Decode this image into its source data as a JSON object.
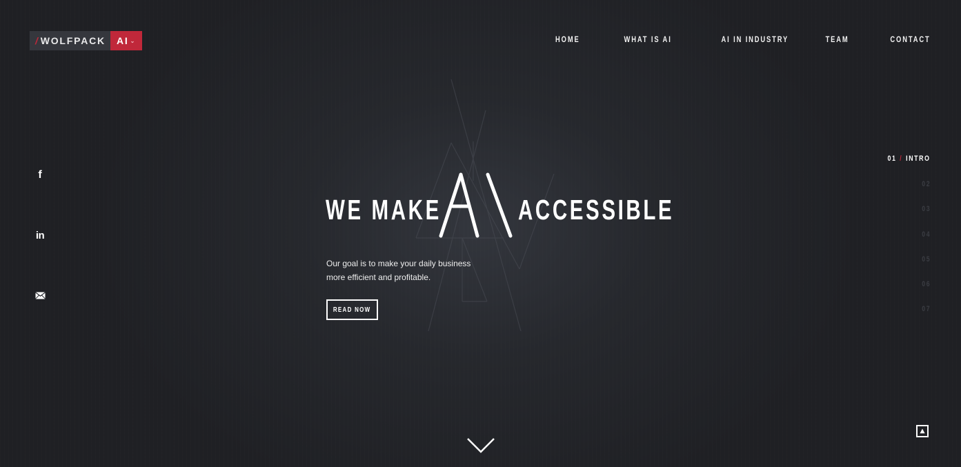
{
  "brand": {
    "left_text": "WOLFPACK",
    "right_text": "AI",
    "slash": "/",
    "accent_color": "#c0283a"
  },
  "nav": {
    "items": [
      "HOME",
      "WHAT IS AI",
      "AI IN INDUSTRY",
      "TEAM",
      "CONTACT"
    ]
  },
  "social": {
    "facebook_icon": "facebook-icon",
    "facebook_glyph": "f",
    "linkedin_icon": "linkedin-icon",
    "linkedin_glyph": "in",
    "mail_icon": "mail-icon"
  },
  "hero": {
    "title_left": "WE MAKE",
    "title_mark": "AI",
    "title_right": "ACCESSIBLE",
    "description_line1": "Our goal is to make your daily business",
    "description_line2": "more efficient and profitable.",
    "button_label": "READ NOW"
  },
  "sections": {
    "active_number": "01",
    "active_separator": "/",
    "active_label": "INTRO",
    "others": [
      "02",
      "03",
      "04",
      "05",
      "06",
      "07"
    ]
  },
  "controls": {
    "scroll_down_icon": "chevron-down-icon",
    "back_to_top_icon": "arrow-up-icon"
  },
  "colors": {
    "background": "#1f2024",
    "text": "#ffffff",
    "accent": "#c0283a",
    "dim_text": "#3a3c42"
  }
}
